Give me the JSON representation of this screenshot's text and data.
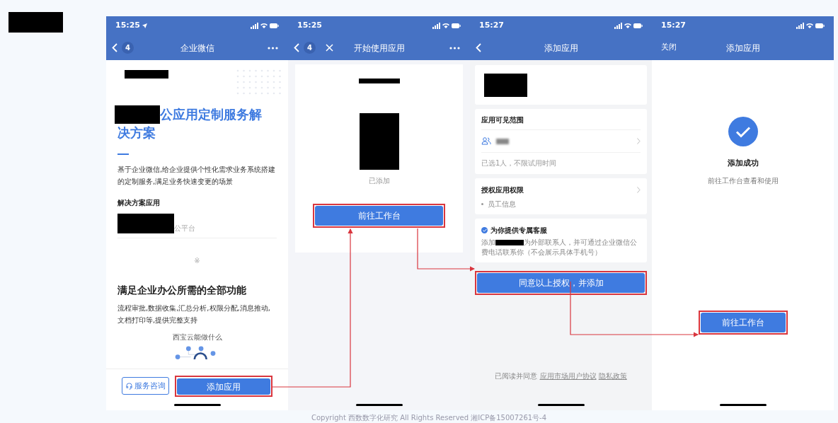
{
  "screens": [
    {
      "kind": "solution",
      "time": "15:25",
      "location_arrow": true,
      "badge": "4",
      "close": false,
      "more": true,
      "title": "企业微信",
      "heading_lines": [
        "公应用定制服务解",
        "决方案"
      ],
      "description": "基于企业微信,给企业提供个性化需求业务系统搭建的定制服务,满足业务快速变更的场景",
      "section_label": "解决方案应用",
      "app_name": "公平台",
      "divider_mark": "※",
      "feature_heading": "满足企业办公所需的全部功能",
      "feature_text": "流程审批,数据收集,汇总分析,权限分配,消息推动,文档打印等,提供完整支持",
      "diagram_title": "西宝云能做什么",
      "buttons": [
        {
          "label": "服务咨询",
          "kind": "outline",
          "highlighted": false
        },
        {
          "label": "添加应用",
          "kind": "primary",
          "highlighted": true
        }
      ]
    },
    {
      "kind": "start",
      "time": "15:25",
      "location_arrow": false,
      "badge": "4",
      "close": true,
      "more": true,
      "title": "开始使用应用",
      "status": "已添加",
      "button": {
        "label": "前往工作台",
        "highlighted": true
      }
    },
    {
      "kind": "authorize",
      "time": "15:27",
      "location_arrow": false,
      "close": false,
      "more": false,
      "title": "添加应用",
      "visible_range_label": "应用可见范围",
      "selection_note": "已选1人，不限试用时间",
      "permission_label": "授权应用权限",
      "permissions": [
        "员工信息"
      ],
      "service": {
        "checked": true,
        "title": "为你提供专属客服",
        "text_before": "添加",
        "text_after": "为外部联系人，并可通过企业微信公费电话联系你（不会展示具体手机号）"
      },
      "button": {
        "label": "同意以上授权，并添加",
        "highlighted": true
      },
      "agreement": {
        "text": "已阅读并同意",
        "links": [
          "应用市场用户协议",
          "隐私政策"
        ]
      }
    },
    {
      "kind": "success",
      "time": "15:27",
      "location_arrow": false,
      "close": false,
      "more": false,
      "left_action": "关闭",
      "title": "添加应用",
      "result_title": "添加成功",
      "result_text": "前往工作台查看和使用",
      "button": {
        "label": "前往工作台",
        "highlighted": true
      }
    }
  ],
  "footer": "Copyright 西数数字化研究 All Rights Reserved 湘ICP备15007261号-4"
}
